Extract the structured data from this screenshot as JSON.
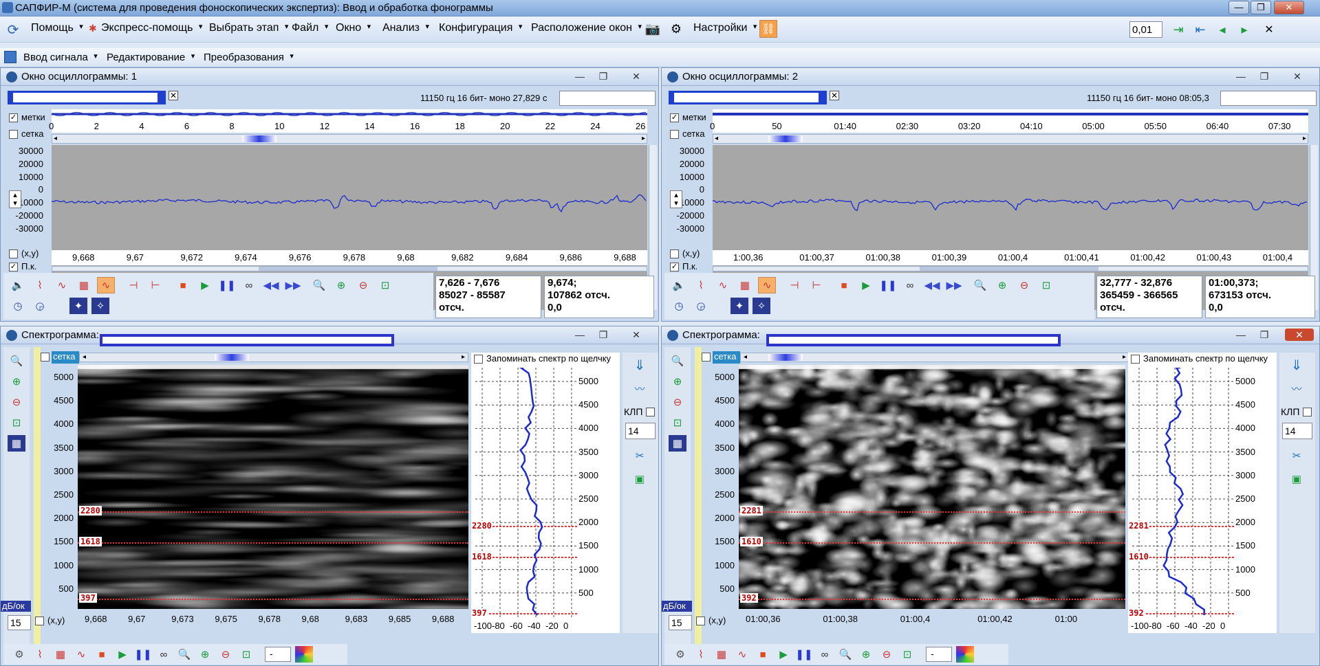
{
  "app": {
    "title": "САПФИР-М (система для проведения фоноскопических экспертиз): Ввод и обработка фонограммы"
  },
  "menu": {
    "items": [
      "Помощь",
      "Экспресс-помощь",
      "Выбрать этап",
      "Файл",
      "Окно",
      "Анализ",
      "Конфигурация",
      "Расположение окон",
      "Настройки"
    ],
    "step_value": "0,01"
  },
  "toolbar2": {
    "items": [
      "Ввод сигнала",
      "Редактирование",
      "Преобразования"
    ]
  },
  "osc1": {
    "title": "Окно осциллограммы: 1",
    "info": "11150 гц 16 бит- моно 27,829 с",
    "labels": {
      "marks": "метки",
      "grid": "сетка",
      "xy": "(x,y)",
      "pk": "П.к."
    },
    "top_axis": [
      "0",
      "2",
      "4",
      "6",
      "8",
      "10",
      "12",
      "14",
      "16",
      "18",
      "20",
      "22",
      "24",
      "26"
    ],
    "y_axis": [
      "30000",
      "20000",
      "10000",
      "0",
      "-10000",
      "-20000",
      "-30000"
    ],
    "x_axis": [
      "9,668",
      "9,67",
      "9,672",
      "9,674",
      "9,676",
      "9,678",
      "9,68",
      "9,682",
      "9,684",
      "9,686",
      "9,688"
    ],
    "sel": {
      "l1": "7,626 - 7,676",
      "l2": "85027 - 85587",
      "l3": "отсч."
    },
    "pos": {
      "l1": "9,674;",
      "l2": "107862 отсч.",
      "l3": "0,0"
    }
  },
  "osc2": {
    "title": "Окно осциллограммы: 2",
    "info": "11150 гц 16 бит- моно 08:05,3",
    "labels": {
      "marks": "метки",
      "grid": "сетка",
      "xy": "(x,y)",
      "pk": "П.к."
    },
    "top_axis": [
      "0",
      "50",
      "01:40",
      "02:30",
      "03:20",
      "04:10",
      "05:00",
      "05:50",
      "06:40",
      "07:30"
    ],
    "y_axis": [
      "30000",
      "20000",
      "10000",
      "0",
      "-10000",
      "-20000",
      "-30000"
    ],
    "x_axis": [
      "1:00,36",
      "01:00,37",
      "01:00,38",
      "01:00,39",
      "01:00,4",
      "01:00,41",
      "01:00,42",
      "01:00,43",
      "01:00,4"
    ],
    "sel": {
      "l1": "32,777 - 32,876",
      "l2": "365459 - 366565",
      "l3": "отсч."
    },
    "pos": {
      "l1": "01:00,373;",
      "l2": "673153 отсч.",
      "l3": "0,0"
    }
  },
  "spec1": {
    "title": "Спектрограмма:",
    "grid": "сетка",
    "remember": "Запоминать спектр по щелчку",
    "y_axis": [
      "5000",
      "4500",
      "4000",
      "3500",
      "3000",
      "2500",
      "2000",
      "1500",
      "1000",
      "500"
    ],
    "x_axis": [
      "9,668",
      "9,67",
      "9,673",
      "9,675",
      "9,678",
      "9,68",
      "9,683",
      "9,685",
      "9,688"
    ],
    "markers": [
      "2280",
      "1618",
      "397"
    ],
    "side_x": [
      "-100",
      "-80",
      "-60",
      "-40",
      "-20",
      "0"
    ],
    "side_y": [
      "5000",
      "4500",
      "4000",
      "3500",
      "3000",
      "2500",
      "2000",
      "1500",
      "1000",
      "500"
    ],
    "klp": "КЛП",
    "klp_val": "14",
    "dbok": "дБ/ок",
    "dbok_val": "15",
    "xy": "(x,y)",
    "zoom_val": "-"
  },
  "spec2": {
    "title": "Спектрограмма:",
    "grid": "сетка",
    "remember": "Запоминать спектр по щелчку",
    "y_axis": [
      "5000",
      "4500",
      "4000",
      "3500",
      "3000",
      "2500",
      "2000",
      "1500",
      "1000",
      "500"
    ],
    "x_axis": [
      "01:00,36",
      "01:00,38",
      "01:00,4",
      "01:00,42",
      "01:00"
    ],
    "markers": [
      "2281",
      "1610",
      "392"
    ],
    "side_x": [
      "-100",
      "-80",
      "-60",
      "-40",
      "-20",
      "0"
    ],
    "side_y": [
      "5000",
      "4500",
      "4000",
      "3500",
      "3000",
      "2500",
      "2000",
      "1500",
      "1000",
      "500"
    ],
    "klp": "КЛП",
    "klp_val": "14",
    "dbok": "дБ/ок",
    "dbok_val": "15",
    "xy": "(x,y)",
    "zoom_val": "-"
  }
}
